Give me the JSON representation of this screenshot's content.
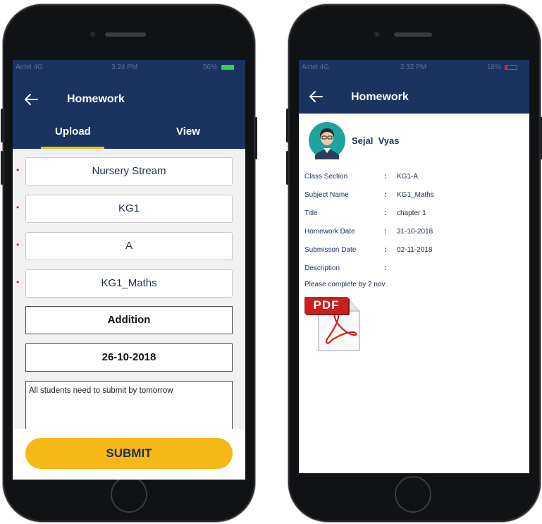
{
  "left_phone": {
    "status": {
      "carrier": "Airtel 4G",
      "time": "3:24 PM",
      "battery": "56%"
    },
    "header": {
      "title": "Homework"
    },
    "tabs": [
      {
        "label": "Upload",
        "active": true
      },
      {
        "label": "View",
        "active": false
      }
    ],
    "fields": [
      {
        "value": "Nursery Stream",
        "required": true
      },
      {
        "value": "KG1",
        "required": true
      },
      {
        "value": "A",
        "required": true
      },
      {
        "value": "KG1_Maths",
        "required": true
      },
      {
        "value": "Addition",
        "required": false
      },
      {
        "value": "26-10-2018",
        "required": false
      }
    ],
    "description": "All students need to submit by tomorrow",
    "submit_label": "SUBMIT"
  },
  "right_phone": {
    "status": {
      "carrier": "Airtel 4G",
      "time": "2:32 PM",
      "battery": "18%"
    },
    "header": {
      "title": "Homework"
    },
    "student_name": "Sejal  Vyas",
    "details": [
      {
        "label": "Class Section",
        "value": "KG1-A"
      },
      {
        "label": "Subject Name",
        "value": "KG1_Maths"
      },
      {
        "label": "Title",
        "value": "chapter 1"
      },
      {
        "label": "Homework Date",
        "value": "31-10-2018"
      },
      {
        "label": "Submisson Date",
        "value": "02-11-2018"
      },
      {
        "label": "Description",
        "value": ""
      }
    ],
    "description_text": "Please complete by 2 nov",
    "attachment_label": "PDF"
  },
  "colors": {
    "navy": "#1a3361",
    "accent": "#f5b816",
    "required": "#e02020"
  }
}
